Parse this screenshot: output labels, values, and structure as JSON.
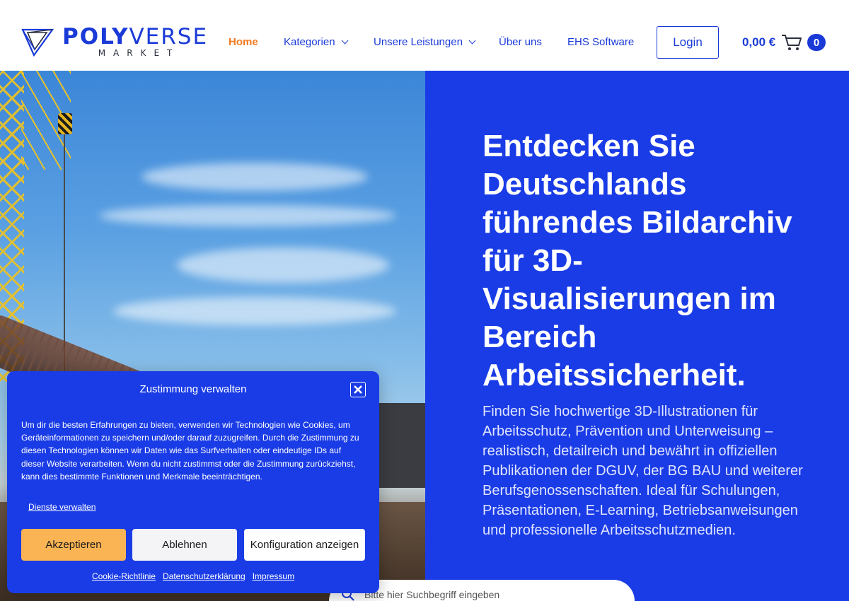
{
  "header": {
    "logo": {
      "word_bold": "POLY",
      "word_light": "VERSE",
      "sub": "MARKET"
    },
    "nav": [
      {
        "label": "Home",
        "active": true
      },
      {
        "label": "Kategorien",
        "dropdown": true
      },
      {
        "label": "Unsere Leistungen",
        "dropdown": true
      },
      {
        "label": "Über uns"
      },
      {
        "label": "EHS Software"
      }
    ],
    "login_label": "Login",
    "cart_total": "0,00 €",
    "cart_count": "0"
  },
  "hero": {
    "title": "Entdecken Sie Deutschlands führendes Bildarchiv für 3D-Visualisierungen im Bereich Arbeitssicherheit.",
    "text": "Finden Sie hochwertige 3D-Illustrationen für Arbeitsschutz, Prävention und Unterweisung – realistisch, detailreich und bewährt in offiziellen Publikationen der DGUV, der BG BAU und weiterer Berufsgenossenschaften. Ideal für Schulungen, Präsentationen, E-Learning, Betriebsanweisungen und professionelle Arbeitsschutzmedien.",
    "search_placeholder": "Bitte hier Suchbegriff eingeben"
  },
  "cookie": {
    "title": "Zustimmung verwalten",
    "body": "Um dir die besten Erfahrungen zu bieten, verwenden wir Technologien wie Cookies, um Geräteinformationen zu speichern und/oder darauf zuzugreifen. Durch die Zustimmung zu diesen Technologien können wir Daten wie das Surfverhalten oder eindeutige IDs auf dieser Website verarbeiten. Wenn du nicht zustimmst oder die Zustimmung zurückziehst, kann dies bestimmte Funktionen und Merkmale beeinträchtigen.",
    "manage_link": "Dienste verwalten",
    "accept_label": "Akzeptieren",
    "deny_label": "Ablehnen",
    "config_label": "Konfiguration anzeigen",
    "footer_links": [
      "Cookie-Richtlinie",
      "Datenschutzerklärung",
      "Impressum"
    ]
  },
  "colors": {
    "brand_blue": "#1a3ce6",
    "active_nav": "#f47b20",
    "accept_button": "#fbb454"
  }
}
